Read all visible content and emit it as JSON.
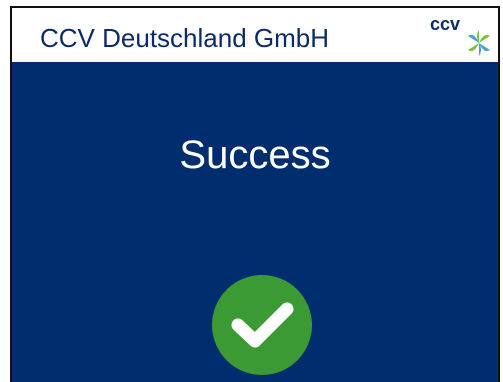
{
  "header": {
    "title": "CCV Deutschland GmbH",
    "logo_text": "ccv"
  },
  "main": {
    "status": "Success",
    "status_icon": "check-circle-icon"
  },
  "colors": {
    "header_background": "#ffffff",
    "title_text": "#0c2a66",
    "main_background": "#002d6e",
    "status_text": "#ffffff",
    "success_green": "#3c9a35",
    "logo_leaf_green": "#7fbf3f",
    "logo_leaf_blue": "#4a9fd8"
  }
}
